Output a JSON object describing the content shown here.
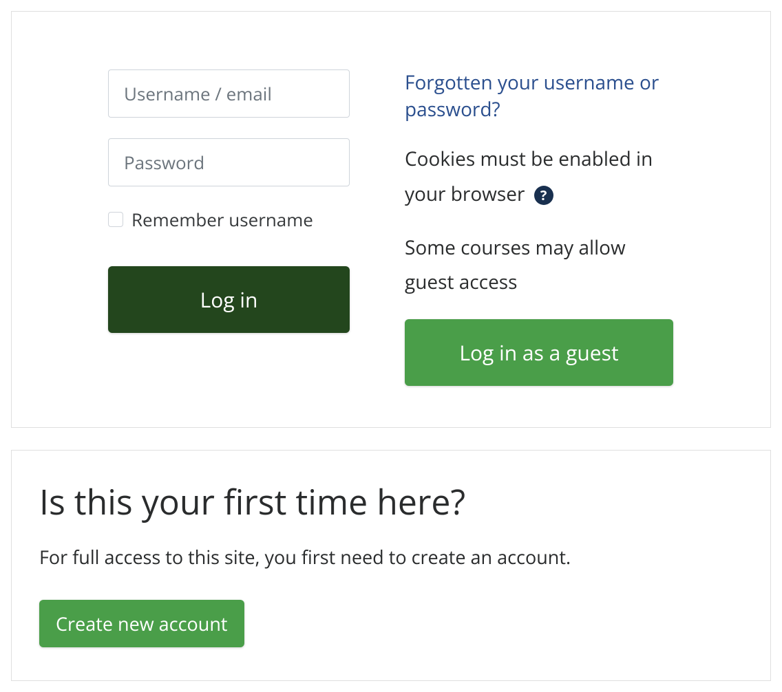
{
  "login": {
    "username_placeholder": "Username / email",
    "password_placeholder": "Password",
    "remember_label": "Remember username",
    "login_button": "Log in",
    "forgot_link": "Forgotten your username or password?",
    "cookies_text_prefix": "Cookies must be enabled in your browser",
    "help_icon_symbol": "?",
    "guest_text": "Some courses may allow guest access",
    "guest_button": "Log in as a guest"
  },
  "signup": {
    "heading": "Is this your first time here?",
    "text": "For full access to this site, you first need to create an account.",
    "create_button": "Create new account"
  }
}
